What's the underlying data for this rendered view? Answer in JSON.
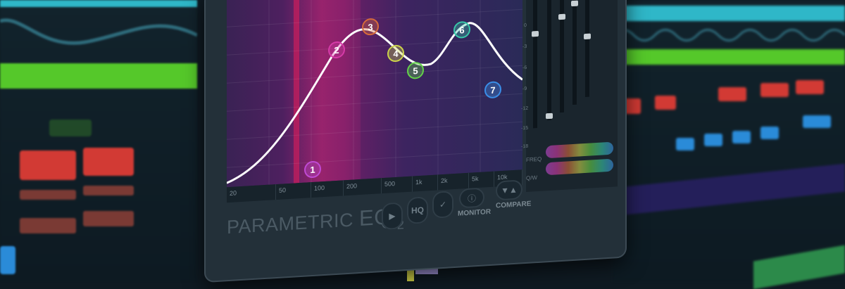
{
  "plugin": {
    "brand_main": "PARAMETRIC",
    "brand_eq": "EQ",
    "brand_sub": "2"
  },
  "freq_labels": [
    "20",
    "50",
    "100",
    "200",
    "500",
    "1k",
    "2k",
    "5k",
    "10k"
  ],
  "meter_side_labels": [
    "FREQ",
    "Q/W"
  ],
  "meter_ticks": [
    "0",
    "-3",
    "-6",
    "-9",
    "-12",
    "-15",
    "-18"
  ],
  "buttons": {
    "play_icon": "play-icon",
    "hq_label": "HQ",
    "check_icon": "check-icon",
    "monitor_label": "MONITOR",
    "compare_label": "COMPARE"
  },
  "nodes": [
    {
      "label": "1",
      "color": "#c04ad4"
    },
    {
      "label": "2",
      "color": "#d63ba8"
    },
    {
      "label": "3",
      "color": "#d66a3a"
    },
    {
      "label": "4",
      "color": "#cbd24a"
    },
    {
      "label": "5",
      "color": "#64d24a"
    },
    {
      "label": "6",
      "color": "#38c7a8"
    },
    {
      "label": "7",
      "color": "#3a8ee8"
    }
  ],
  "colors": {
    "cyan_bar": "#2fb7c8",
    "green_bar": "#55c82a",
    "red_pad": "#d23a34",
    "blue_pad": "#2a8bd8",
    "curve": "#ffffff"
  }
}
